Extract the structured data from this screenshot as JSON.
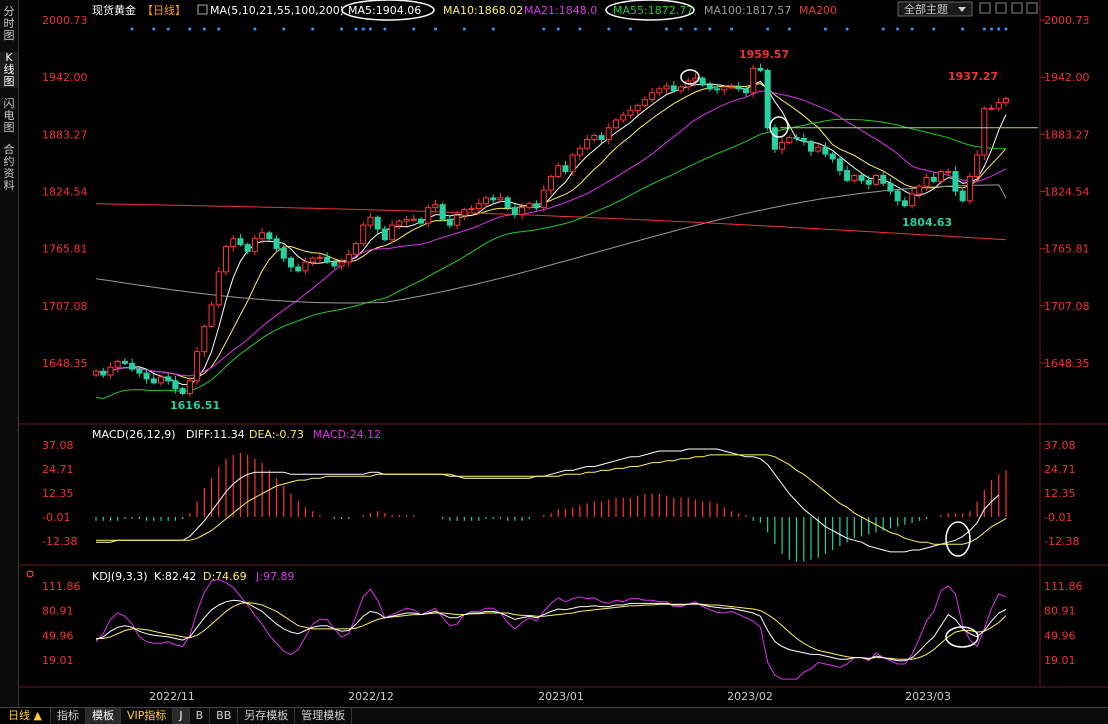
{
  "sidebar": {
    "items": [
      {
        "label": "分时图",
        "active": false
      },
      {
        "label": "K线图",
        "active": true
      },
      {
        "label": "闪电图",
        "active": false
      },
      {
        "label": "合约资料",
        "active": false
      }
    ]
  },
  "header": {
    "symbol": "现货黄金",
    "period": "【日线】",
    "ma_label": "MA(5,10,21,55,100,200)",
    "ma5": "MA5:1904.06",
    "ma10": "MA10:1868.02",
    "ma21": "MA21:1848.0",
    "ma55": "MA55:1872.77",
    "ma100": "MA100:1817.57",
    "ma200": "MA200",
    "theme_select": "全部主题"
  },
  "macd_header": {
    "name": "MACD(26,12,9)",
    "diff": "DIFF:11.34",
    "dea": "DEA:-0.73",
    "macd": "MACD:24.12"
  },
  "kdj_header": {
    "name": "KDJ(9,3,3)",
    "k": "K:82.42",
    "d": "D:74.69",
    "j": "J:97.89"
  },
  "annotations": {
    "high": "1959.57",
    "low": "1616.51",
    "recent_high": "1937.27",
    "recent_low": "1804.63"
  },
  "bottom_bar": {
    "period": "日线",
    "tabs": [
      "指标",
      "模板",
      "VIP指标",
      "J",
      "B",
      "BB",
      "另存模板",
      "管理模板"
    ]
  },
  "colors": {
    "up": "#ff3333",
    "down": "#27d0a0",
    "ma5": "#ffffff",
    "ma10": "#ffee66",
    "ma21": "#dd33ee",
    "ma55": "#22cc22",
    "ma100": "#999999",
    "ma200": "#ee3333",
    "axis_text": "#ee3333"
  },
  "chart_data": [
    {
      "type": "candlestick",
      "title": "现货黄金 日线",
      "x_labels": [
        "2022/11",
        "2022/12",
        "2023/01",
        "2023/02",
        "2023/03"
      ],
      "y_ticks": [
        2000.73,
        1942.0,
        1883.27,
        1824.54,
        1765.81,
        1707.08,
        1648.35
      ],
      "ylim": [
        1605,
        2005
      ],
      "closes": [
        1640,
        1636,
        1644,
        1650,
        1648,
        1642,
        1638,
        1632,
        1628,
        1634,
        1630,
        1622,
        1617,
        1630,
        1660,
        1686,
        1708,
        1742,
        1768,
        1776,
        1770,
        1763,
        1776,
        1782,
        1776,
        1766,
        1756,
        1747,
        1743,
        1752,
        1756,
        1757,
        1752,
        1748,
        1752,
        1760,
        1771,
        1790,
        1798,
        1786,
        1775,
        1790,
        1794,
        1796,
        1796,
        1792,
        1808,
        1811,
        1796,
        1790,
        1800,
        1806,
        1807,
        1812,
        1818,
        1816,
        1818,
        1808,
        1801,
        1808,
        1812,
        1808,
        1826,
        1840,
        1851,
        1845,
        1862,
        1869,
        1878,
        1882,
        1878,
        1890,
        1898,
        1903,
        1908,
        1913,
        1919,
        1926,
        1930,
        1933,
        1928,
        1932,
        1938,
        1941,
        1934,
        1930,
        1929,
        1932,
        1932,
        1930,
        1926,
        1951,
        1949,
        1890,
        1868,
        1875,
        1880,
        1879,
        1876,
        1866,
        1870,
        1863,
        1858,
        1846,
        1836,
        1841,
        1836,
        1832,
        1841,
        1833,
        1825,
        1815,
        1810,
        1822,
        1830,
        1839,
        1835,
        1845,
        1845,
        1825,
        1815,
        1840,
        1862,
        1910,
        1910,
        1916,
        1920
      ],
      "ma55_last": 1872.77,
      "ma100_last": 1817.57,
      "series": [
        {
          "name": "MA5",
          "last": 1904.06
        },
        {
          "name": "MA10",
          "last": 1868.02
        },
        {
          "name": "MA21",
          "last": 1848.0
        },
        {
          "name": "MA55",
          "last": 1872.77
        },
        {
          "name": "MA100",
          "last": 1817.57
        },
        {
          "name": "MA200",
          "first": 1812,
          "last": 1775
        }
      ],
      "hline": 1890
    },
    {
      "type": "bar",
      "title": "MACD(26,12,9)",
      "y_ticks": [
        37.08,
        24.71,
        12.35,
        -0.01,
        -12.38
      ],
      "ylim": [
        -25,
        40
      ],
      "macd_values": [
        -2,
        -2,
        -2,
        -2,
        -1,
        -1,
        -1,
        -2,
        -2,
        -2,
        -2,
        -2,
        -1,
        2,
        8,
        15,
        20,
        26,
        30,
        32,
        33,
        32,
        30,
        28,
        24,
        20,
        16,
        12,
        8,
        5,
        3,
        1,
        0,
        -1,
        -1,
        -1,
        0,
        1,
        2,
        3,
        2,
        1,
        1,
        1,
        1,
        0,
        0,
        0,
        -1,
        -2,
        -2,
        -2,
        -2,
        -2,
        -1,
        -1,
        -1,
        -2,
        -2,
        -2,
        -1,
        0,
        1,
        2,
        4,
        4,
        5,
        6,
        7,
        8,
        8,
        9,
        10,
        10,
        10,
        11,
        12,
        12,
        12,
        11,
        10,
        10,
        10,
        9,
        8,
        8,
        7,
        5,
        3,
        2,
        1,
        -2,
        -3,
        -8,
        -14,
        -19,
        -22,
        -23,
        -23,
        -22,
        -21,
        -19,
        -17,
        -15,
        -13,
        -11,
        -10,
        -9,
        -8,
        -7,
        -6,
        -5,
        -4,
        -3,
        -2,
        -1,
        0,
        1,
        2,
        2,
        2,
        3,
        8,
        14,
        19,
        22,
        24.12
      ],
      "diff_values": [
        -13,
        -13,
        -13,
        -12,
        -12,
        -12,
        -12,
        -12,
        -12,
        -12,
        -12,
        -12,
        -12,
        -10,
        -6,
        -2,
        3,
        8,
        13,
        17,
        20,
        22,
        23,
        23,
        23,
        23,
        23,
        22,
        22,
        22,
        22,
        22,
        22,
        22,
        22,
        22,
        22,
        22,
        23,
        23,
        22,
        22,
        22,
        22,
        22,
        22,
        22,
        22,
        22,
        21,
        21,
        20,
        20,
        20,
        20,
        20,
        20,
        20,
        20,
        20,
        20,
        21,
        21,
        22,
        23,
        24,
        24,
        25,
        26,
        26,
        27,
        28,
        29,
        30,
        31,
        31,
        32,
        33,
        34,
        34,
        34,
        34,
        35,
        35,
        35,
        35,
        35,
        34,
        33,
        32,
        31,
        31,
        30,
        27,
        22,
        17,
        12,
        8,
        4,
        1,
        -2,
        -5,
        -7,
        -9,
        -11,
        -12,
        -13,
        -15,
        -16,
        -17,
        -18,
        -18,
        -18,
        -17,
        -17,
        -16,
        -15,
        -14,
        -13,
        -12,
        -10,
        -7,
        -3,
        4,
        8,
        11.34
      ],
      "dea_values": [
        -12,
        -12,
        -12,
        -12,
        -12,
        -12,
        -12,
        -12,
        -12,
        -12,
        -12,
        -12,
        -12,
        -12,
        -11,
        -9,
        -7,
        -4,
        -1,
        2,
        5,
        8,
        10,
        12,
        14,
        16,
        17,
        18,
        19,
        19,
        20,
        20,
        21,
        21,
        21,
        21,
        21,
        21,
        21,
        22,
        22,
        22,
        22,
        22,
        22,
        22,
        22,
        22,
        22,
        22,
        21,
        21,
        21,
        21,
        21,
        21,
        21,
        21,
        21,
        21,
        21,
        21,
        21,
        21,
        21,
        22,
        22,
        22,
        23,
        23,
        24,
        24,
        25,
        25,
        26,
        26,
        27,
        28,
        28,
        29,
        29,
        30,
        30,
        31,
        31,
        32,
        32,
        32,
        32,
        32,
        32,
        32,
        32,
        32,
        31,
        29,
        27,
        24,
        22,
        19,
        16,
        13,
        10,
        7,
        5,
        2,
        0,
        -2,
        -4,
        -6,
        -8,
        -9,
        -11,
        -12,
        -13,
        -13,
        -14,
        -14,
        -14,
        -14,
        -14,
        -13,
        -11,
        -8,
        -5,
        -3,
        -0.73
      ]
    },
    {
      "type": "line",
      "title": "KDJ(9,3,3)",
      "y_ticks": [
        111.86,
        80.91,
        49.96,
        19.01
      ],
      "ylim": [
        -5,
        125
      ],
      "series": [
        {
          "name": "K",
          "last": 82.42
        },
        {
          "name": "D",
          "last": 74.69
        },
        {
          "name": "J",
          "last": 97.89
        }
      ],
      "k_values": [
        45,
        48,
        55,
        60,
        62,
        60,
        55,
        52,
        50,
        49,
        48,
        46,
        44,
        48,
        60,
        72,
        82,
        88,
        92,
        94,
        93,
        90,
        85,
        80,
        72,
        64,
        58,
        54,
        52,
        56,
        60,
        62,
        62,
        58,
        55,
        56,
        64,
        74,
        80,
        78,
        72,
        74,
        76,
        78,
        78,
        76,
        78,
        80,
        76,
        72,
        72,
        76,
        78,
        78,
        80,
        80,
        78,
        74,
        70,
        72,
        74,
        72,
        76,
        80,
        83,
        82,
        84,
        86,
        86,
        87,
        86,
        86,
        88,
        88,
        90,
        90,
        90,
        90,
        90,
        90,
        88,
        88,
        89,
        90,
        88,
        86,
        85,
        84,
        84,
        82,
        80,
        78,
        74,
        56,
        42,
        36,
        32,
        30,
        28,
        26,
        26,
        24,
        22,
        20,
        20,
        22,
        22,
        20,
        24,
        22,
        20,
        18,
        18,
        22,
        30,
        40,
        48,
        62,
        76,
        70,
        58,
        52,
        48,
        56,
        68,
        78,
        82.42
      ],
      "d_values": [
        46,
        46,
        48,
        52,
        56,
        58,
        58,
        57,
        55,
        53,
        51,
        50,
        48,
        47,
        50,
        56,
        64,
        72,
        80,
        86,
        90,
        91,
        90,
        88,
        84,
        80,
        74,
        68,
        62,
        60,
        58,
        58,
        58,
        58,
        58,
        58,
        59,
        62,
        66,
        70,
        72,
        73,
        74,
        75,
        76,
        76,
        77,
        78,
        78,
        77,
        76,
        76,
        77,
        77,
        78,
        78,
        78,
        78,
        76,
        75,
        75,
        74,
        74,
        75,
        76,
        77,
        78,
        80,
        81,
        82,
        83,
        84,
        85,
        86,
        87,
        87,
        88,
        88,
        89,
        89,
        89,
        89,
        89,
        89,
        89,
        88,
        88,
        87,
        86,
        85,
        84,
        83,
        81,
        76,
        70,
        62,
        54,
        46,
        40,
        35,
        31,
        29,
        27,
        25,
        23,
        22,
        22,
        21,
        22,
        22,
        21,
        20,
        20,
        20,
        22,
        26,
        32,
        40,
        48,
        54,
        56,
        56,
        54,
        55,
        60,
        66,
        74.69
      ],
      "j_values": [
        42,
        52,
        70,
        78,
        74,
        64,
        48,
        42,
        40,
        40,
        42,
        38,
        36,
        50,
        80,
        104,
        118,
        120,
        116,
        110,
        99,
        88,
        75,
        64,
        50,
        40,
        30,
        26,
        32,
        48,
        64,
        70,
        70,
        58,
        48,
        52,
        74,
        98,
        108,
        94,
        72,
        76,
        80,
        84,
        82,
        76,
        80,
        84,
        72,
        62,
        64,
        76,
        80,
        80,
        84,
        84,
        78,
        66,
        58,
        66,
        72,
        68,
        80,
        90,
        97,
        92,
        96,
        98,
        96,
        97,
        92,
        90,
        94,
        92,
        96,
        96,
        94,
        94,
        92,
        92,
        86,
        86,
        89,
        92,
        86,
        82,
        79,
        78,
        80,
        76,
        72,
        68,
        60,
        16,
        0,
        -5,
        -5,
        -5,
        4,
        8,
        16,
        14,
        12,
        10,
        14,
        22,
        22,
        18,
        28,
        22,
        18,
        14,
        14,
        26,
        46,
        68,
        80,
        106,
        112,
        102,
        62,
        44,
        36,
        58,
        84,
        102,
        97.89
      ]
    }
  ]
}
